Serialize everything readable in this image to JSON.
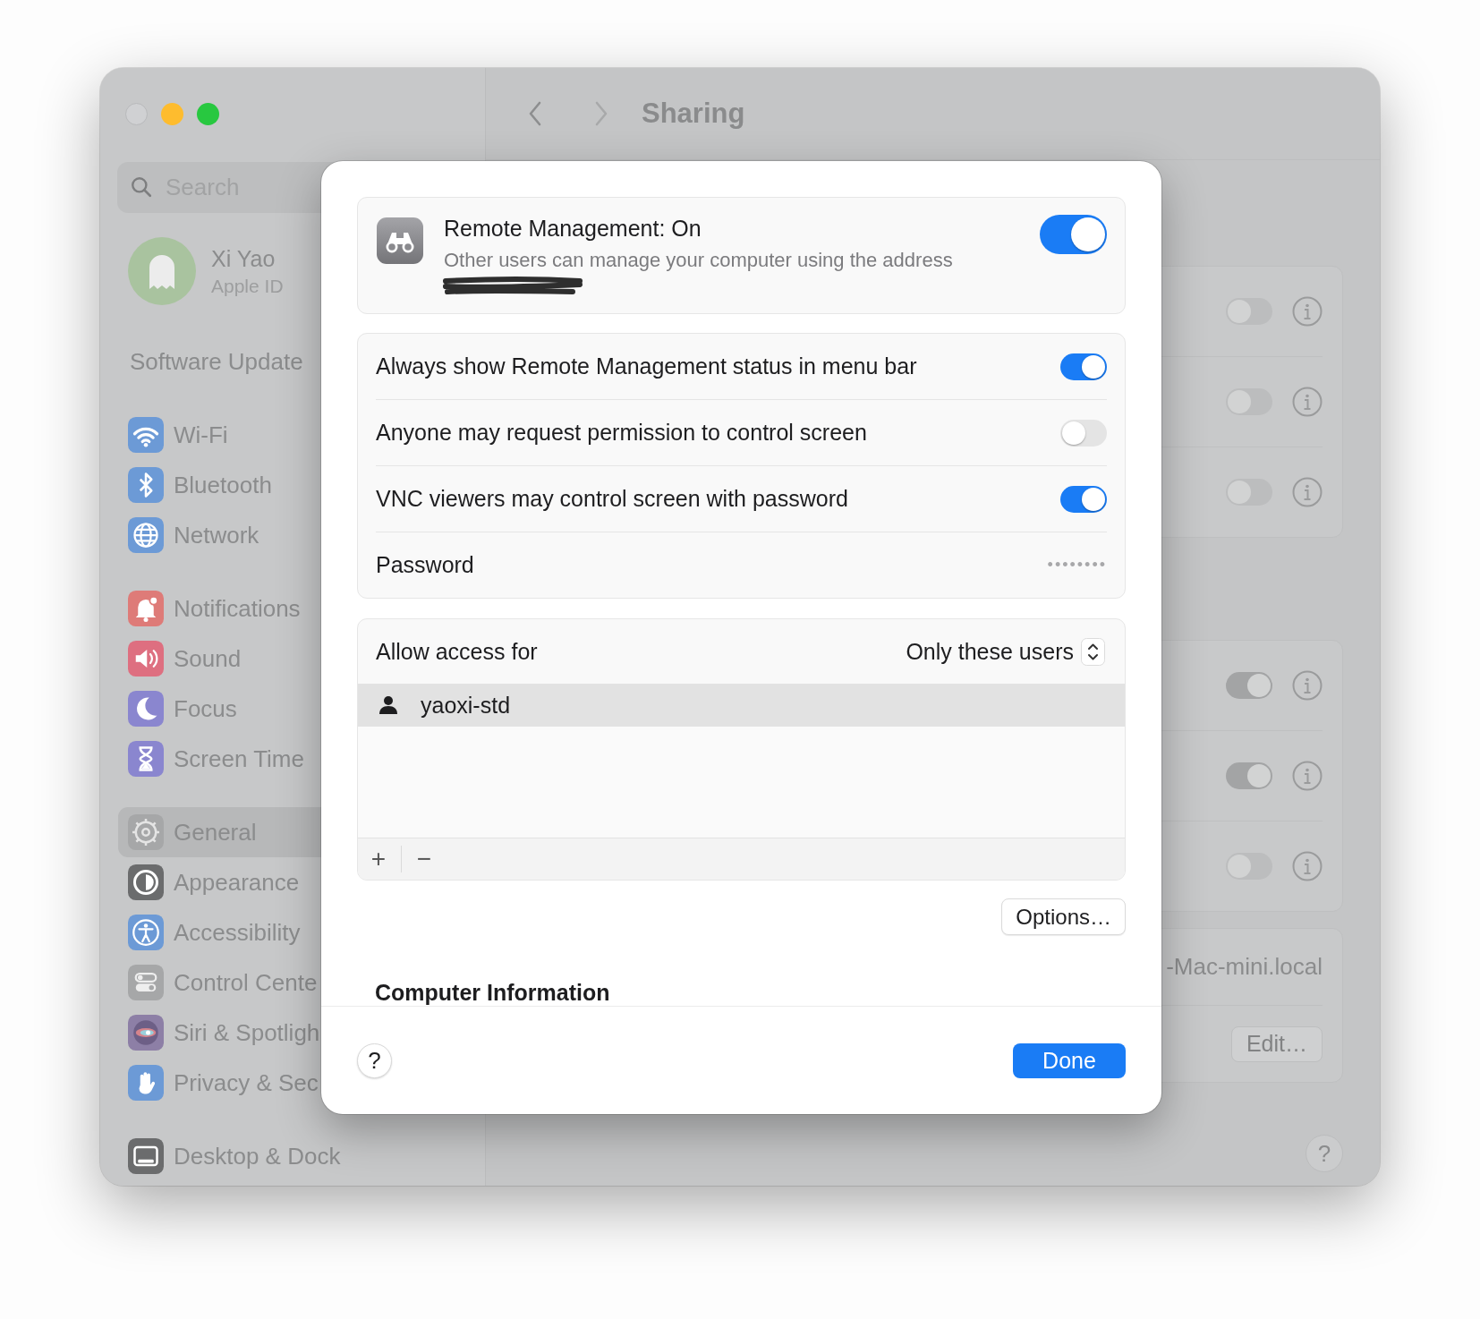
{
  "sidebar": {
    "search": {
      "placeholder": "Search"
    },
    "profile": {
      "name": "Xi Yao",
      "subtitle": "Apple ID"
    },
    "software_update": "Software Update",
    "groups": [
      [
        {
          "label": "Wi-Fi",
          "color": "#6c9ad6",
          "selected": false
        },
        {
          "label": "Bluetooth",
          "color": "#6c9ad6",
          "selected": false
        },
        {
          "label": "Network",
          "color": "#6c9ad6",
          "selected": false
        }
      ],
      [
        {
          "label": "Notifications",
          "color": "#de7b78",
          "selected": false
        },
        {
          "label": "Sound",
          "color": "#de6f80",
          "selected": false
        },
        {
          "label": "Focus",
          "color": "#8a86cf",
          "selected": false
        },
        {
          "label": "Screen Time",
          "color": "#8a86cf",
          "selected": false
        }
      ],
      [
        {
          "label": "General",
          "color": "#a6a7a8",
          "selected": true
        },
        {
          "label": "Appearance",
          "color": "#6b6c6d",
          "selected": false
        },
        {
          "label": "Accessibility",
          "color": "#6c9ad6",
          "selected": false
        },
        {
          "label": "Control Cente",
          "color": "#a6a7a8",
          "selected": false
        },
        {
          "label": "Siri & Spotligh",
          "color": "#8d7fa6",
          "selected": false
        },
        {
          "label": "Privacy & Sec",
          "color": "#6c9ad6",
          "selected": false
        }
      ],
      [
        {
          "label": "Desktop & Dock",
          "color": "#6b6c6d",
          "selected": false
        }
      ]
    ]
  },
  "toolbar": {
    "title": "Sharing"
  },
  "pane": {
    "groups": [
      {
        "rows": [
          {
            "on": false
          },
          {
            "on": false
          },
          {
            "on": false
          }
        ]
      },
      {
        "rows": [
          {
            "on": true
          },
          {
            "on": true
          },
          {
            "on": false
          }
        ]
      }
    ],
    "hostname": "-Mac-mini.local",
    "edit_button": "Edit…",
    "help": "?"
  },
  "dialog": {
    "header": {
      "title": "Remote Management: On",
      "description": "Other users can manage your computer using the address",
      "on": true
    },
    "settings": [
      {
        "kind": "toggle",
        "label": "Always show Remote Management status in menu bar",
        "on": true
      },
      {
        "kind": "toggle",
        "label": "Anyone may request permission to control screen",
        "on": false
      },
      {
        "kind": "toggle",
        "label": "VNC viewers may control screen with password",
        "on": true
      },
      {
        "kind": "secret",
        "label": "Password",
        "value": "••••••••"
      }
    ],
    "access": {
      "label": "Allow access for",
      "value": "Only these users",
      "users": [
        {
          "name": "yaoxi-std",
          "selected": true
        }
      ],
      "add": "+",
      "remove": "−"
    },
    "options_button": "Options…",
    "section_heading": "Computer Information",
    "help": "?",
    "done_button": "Done"
  }
}
